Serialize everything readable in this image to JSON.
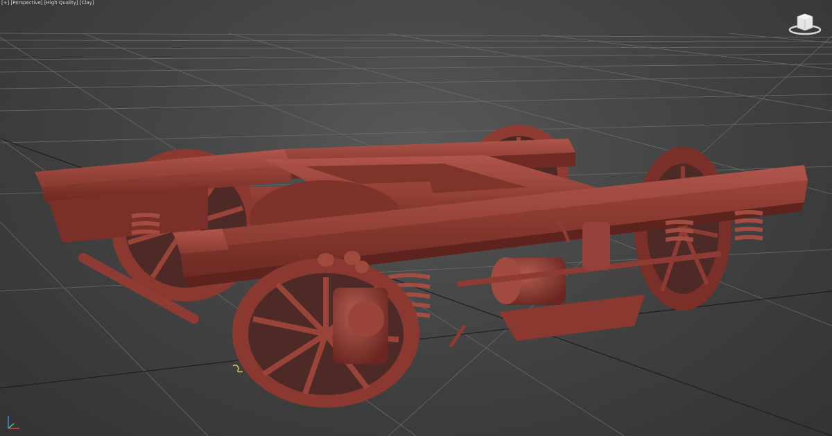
{
  "viewport": {
    "labels": {
      "plus": "[+]",
      "view": "[Perspective]",
      "quality": "[High Quality]",
      "shading": "[Clay]"
    },
    "viewcube": {
      "label": "ViewCube"
    },
    "model": {
      "name": "bogie-model",
      "material_color": "#8e3b33"
    },
    "colors": {
      "background_center": "#5a5a5a",
      "background_edge": "#333333",
      "grid_line": "#6b6b6b",
      "grid_major": "#1e1e1e"
    }
  }
}
